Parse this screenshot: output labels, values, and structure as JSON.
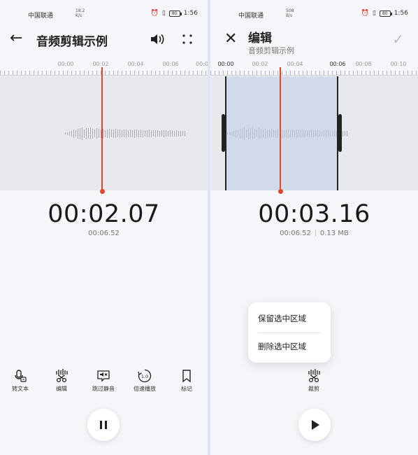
{
  "status": {
    "carrier": "中国联通",
    "left_speed": "18.2\nK/s",
    "right_speed": "508\nB/s",
    "battery": "80",
    "time": "1:56"
  },
  "left_screen": {
    "title": "音频剪辑示例",
    "ruler_labels": [
      "00:00",
      "00:02",
      "00:04",
      "00:06",
      "00:0"
    ],
    "timecode": "00:02.07",
    "total_duration": "00:06.52",
    "tools": [
      {
        "label": "转文本",
        "icon": "transcribe-icon"
      },
      {
        "label": "编辑",
        "icon": "edit-waveform-icon"
      },
      {
        "label": "跳过静音",
        "icon": "skip-silence-icon"
      },
      {
        "label": "倍速播放",
        "icon": "playback-speed-icon"
      },
      {
        "label": "标记",
        "icon": "bookmark-icon"
      }
    ],
    "speed_icon_text": "1.0",
    "play_state": "pause-icon"
  },
  "right_screen": {
    "title": "编辑",
    "subtitle": "音频剪辑示例",
    "ruler_labels": [
      "00:00",
      "00:02",
      "00:04",
      "00:06",
      "00:08",
      "00:10"
    ],
    "timecode": "00:03.16",
    "total_duration": "00:06.52",
    "file_size": "0.13 MB",
    "popup_options": [
      "保留选中区域",
      "删除选中区域"
    ],
    "tool_label": "裁剪",
    "play_state": "play-icon"
  },
  "colors": {
    "playhead": "#e5452d",
    "background": "#f5f6f9",
    "waveform_bg": "#e8e9ec",
    "selection": "#bfcce6"
  }
}
